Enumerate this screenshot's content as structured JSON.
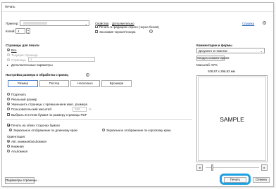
{
  "window": {
    "title": "Печать"
  },
  "printer": {
    "label": "Принтер:",
    "value": "",
    "properties_label": "Свойства",
    "advanced_label": "Дополнительно",
    "help_label": "Справка"
  },
  "copies": {
    "label": "Копий:",
    "value": "1"
  },
  "options": {
    "grayscale_label": "Печать в градациях серого (черно-белая)",
    "saveink_label": "Экономия чернил/тонера"
  },
  "pages": {
    "title": "Страницы для печати",
    "all_label": "Все",
    "current_label": "Текущая страница",
    "range_label": "Страницы",
    "range_value": "1",
    "more_label": "Дополнительные параметры"
  },
  "sizing": {
    "title": "Настройка размера и обработка страниц",
    "tabs": [
      "Размер",
      "Постер",
      "Несколько",
      "Брошюра"
    ],
    "fit_label": "Подогнать",
    "actual_label": "Реальный размер",
    "shrink_label": "Уменьшить страницы с превышением макс. размера",
    "custom_label": "Пользовательский масштаб:",
    "custom_value": "100",
    "custom_unit": "%",
    "source_label": "Выбрать источник бумаги по размеру страницы PDF"
  },
  "duplex": {
    "label": "Печать на обеих сторонах бумаги",
    "long_label": "Зеркальное отображение по длинному краю",
    "short_label": "Зеркальное отображение по короткому краю"
  },
  "orientation": {
    "title": "Ориентация:",
    "auto_label": "Авт. книжная/альбомная",
    "portrait_label": "Книжная",
    "landscape_label": "Альбомная"
  },
  "comments": {
    "title": "Комментарии и формы",
    "value": "Документ и пометки",
    "summarize_label": "Сводка комментариев"
  },
  "preview": {
    "scale_label": "Масштаб: 97%",
    "size_label": "209,97 x 296,93 мм",
    "sample_text": "SAMPLE"
  },
  "footer": {
    "page_setup_label": "Параметры страницы...",
    "print_label": "Печать",
    "cancel_label": "Отмена"
  },
  "colors": {
    "highlight": "#1a9fe0",
    "accent": "#1f5bb5"
  },
  "icons": [
    "help-icon",
    "info-icon",
    "dropdown-icon",
    "stepper-icon",
    "prev-page-icon",
    "next-page-icon",
    "page-slider-icon"
  ]
}
